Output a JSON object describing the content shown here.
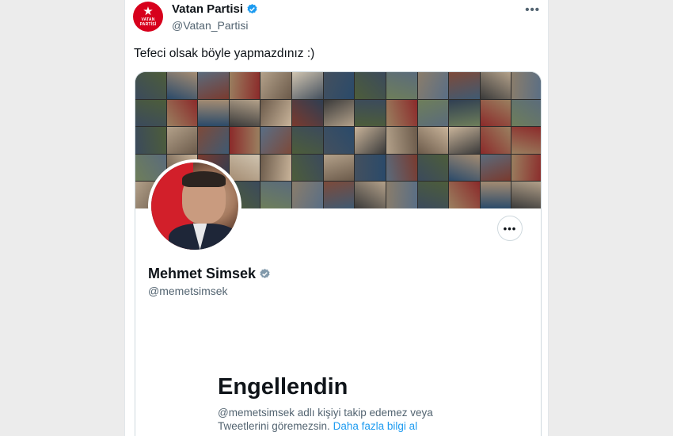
{
  "tweet": {
    "author_name": "Vatan Partisi",
    "author_handle": "@Vatan_Partisi",
    "logo_text": "VATAN PARTİSİ",
    "more_label": "•••",
    "text": "Tefeci olsak böyle yapmazdınız :)"
  },
  "profile_card": {
    "name": "Mehmet Simsek",
    "handle": "@memetsimsek",
    "more_label": "•••",
    "blocked_title": "Engellendin",
    "blocked_desc": "@memetsimsek adlı kişiyi takip edemez veya Tweetlerini göremezsin.",
    "learn_more_link": "Daha fazla bilgi al"
  },
  "colors": {
    "verified_badge": "#1d9bf0",
    "verified_gray": "#829aab",
    "link": "#1d9bf0",
    "party_red": "#d7001c"
  }
}
